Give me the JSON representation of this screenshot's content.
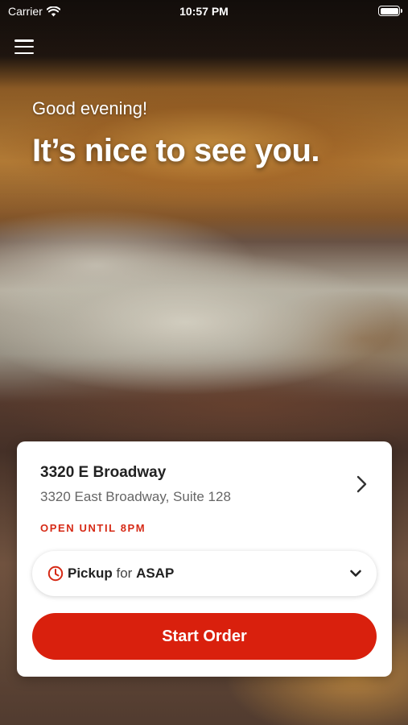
{
  "status_bar": {
    "carrier": "Carrier",
    "time": "10:57 PM"
  },
  "hero": {
    "greeting": "Good evening!",
    "headline": "It’s nice to see you."
  },
  "location": {
    "name": "3320 E Broadway",
    "address": "3320 East Broadway, Suite 128",
    "hours_status": "OPEN UNTIL 8PM"
  },
  "order_mode": {
    "mode": "Pickup",
    "connector": "for",
    "time": "ASAP"
  },
  "actions": {
    "start_order": "Start Order"
  },
  "colors": {
    "accent": "#d9200d",
    "status_red": "#d62a16"
  },
  "icons": [
    "wifi-icon",
    "battery-icon",
    "menu-icon",
    "chevron-right-icon",
    "clock-icon",
    "chevron-down-icon"
  ]
}
